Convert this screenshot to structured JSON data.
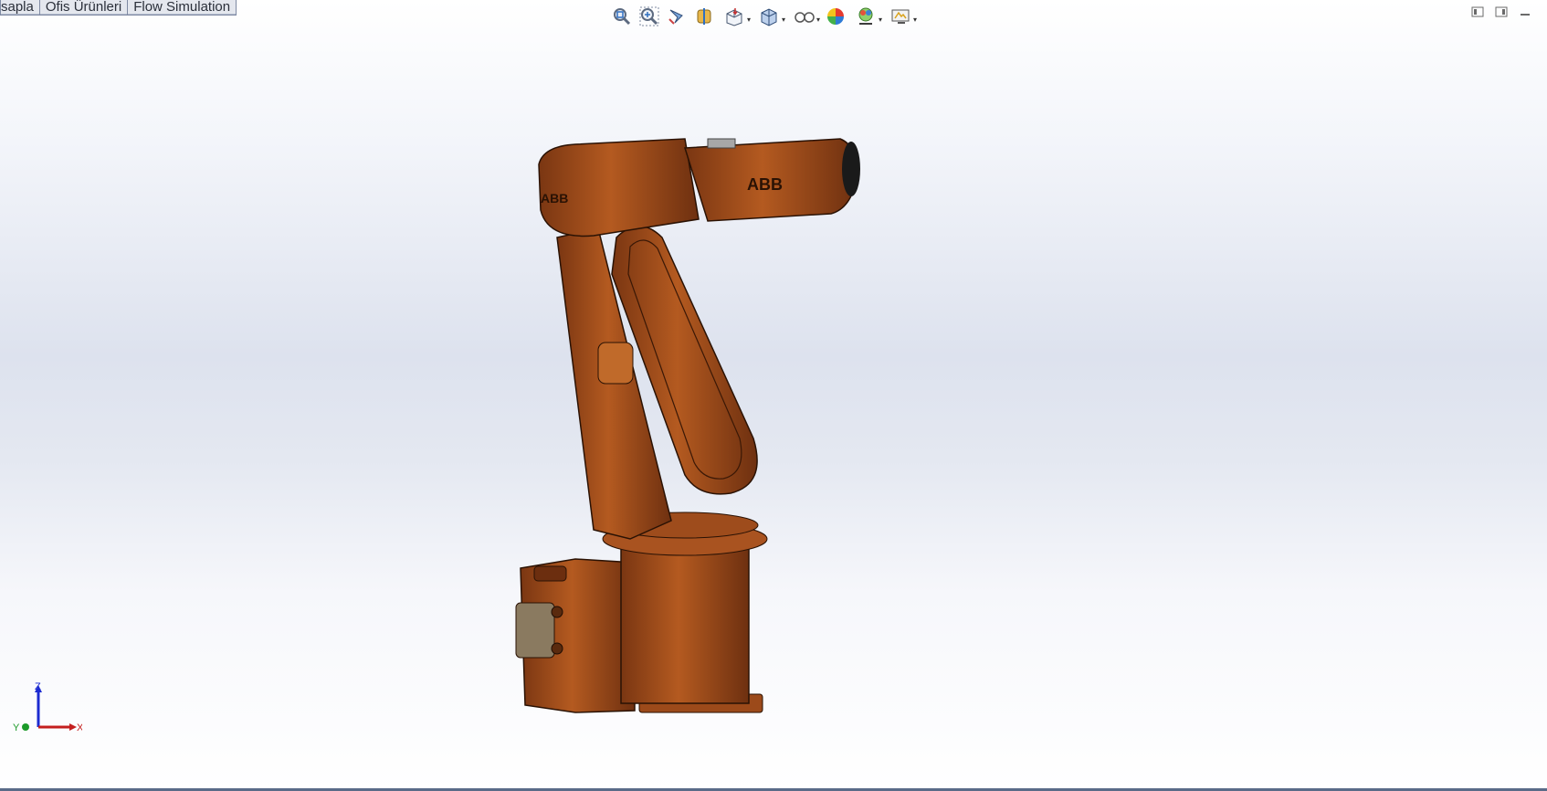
{
  "tabs": [
    {
      "label": "sapla"
    },
    {
      "label": "Ofis Ürünleri"
    },
    {
      "label": "Flow Simulation"
    }
  ],
  "view_toolbar": [
    {
      "icon": "zoom-to-fit-icon"
    },
    {
      "icon": "zoom-to-area-icon"
    },
    {
      "icon": "previous-view-icon"
    },
    {
      "icon": "section-view-icon"
    },
    {
      "icon": "view-orientation-icon",
      "dropdown": true
    },
    {
      "icon": "display-style-icon",
      "dropdown": true
    },
    {
      "icon": "hide-show-items-icon",
      "dropdown": true
    },
    {
      "icon": "edit-appearance-icon"
    },
    {
      "icon": "apply-scene-icon",
      "dropdown": true
    },
    {
      "icon": "view-settings-icon",
      "dropdown": true
    }
  ],
  "window_controls": [
    {
      "icon": "tile-horizontal-icon"
    },
    {
      "icon": "tile-vertical-icon"
    },
    {
      "icon": "minimize-icon"
    }
  ],
  "triad": {
    "z": "Z",
    "y": "Y",
    "x": "X"
  },
  "model": {
    "logo_text": "ABB",
    "color": "#a9501c"
  },
  "colors": {
    "viewport_bg": "#dde2ee",
    "accent": "#5a6b88"
  }
}
